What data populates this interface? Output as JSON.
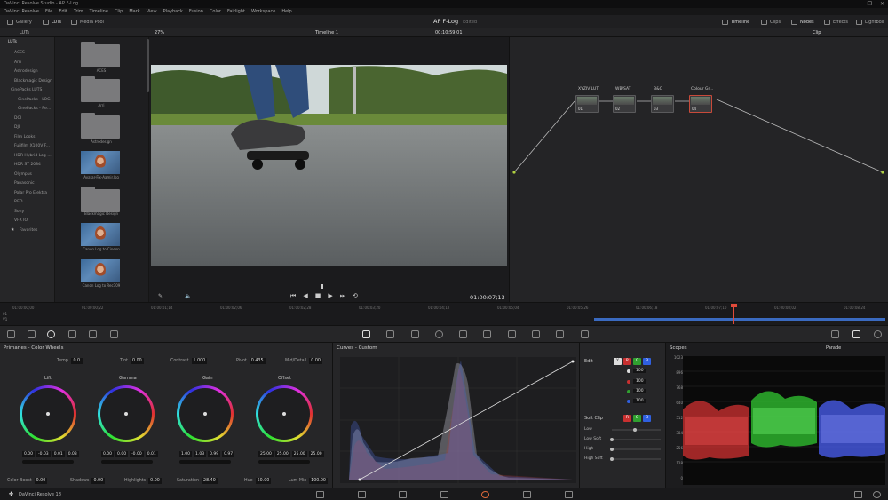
{
  "window": {
    "title": "DaVinci Resolve Studio - AP F-Log",
    "controls": [
      "–",
      "❐",
      "✕"
    ]
  },
  "menu": [
    "DaVinci Resolve",
    "File",
    "Edit",
    "Trim",
    "Timeline",
    "Clip",
    "Mark",
    "View",
    "Playback",
    "Fusion",
    "Color",
    "Fairlight",
    "Workspace",
    "Help"
  ],
  "topbar": {
    "gallery": "Gallery",
    "luts": "LUTs",
    "media_pool": "Media Pool",
    "project": "AP F-Log",
    "edited": "Edited",
    "timeline": "Timeline",
    "clips": "Clips",
    "nodes": "Nodes",
    "effects": "Effects",
    "lightbox": "Lightbox"
  },
  "subbar": {
    "luts_label": "LUTs",
    "zoom": "27%",
    "timeline_name": "Timeline 1",
    "timecode": "00:10:59;01",
    "clip_mode": "Clip"
  },
  "lut_tree": {
    "root": "LUTs",
    "items": [
      "ACES",
      "Arri",
      "Astrodesign",
      "Blackmagic Design",
      "CinePacks LUTS",
      "CinePacks - LOG",
      "CinePacks - Re...",
      "DCI",
      "DJI",
      "Film Looks",
      "Fujifilm X100V F...",
      "HDR Hybrid Log-...",
      "HDR ST 2084",
      "Olympus",
      "Panasonic",
      "Polar Pro Elektra",
      "RED",
      "Sony",
      "VFX IO",
      "Favorites"
    ]
  },
  "lut_thumbs": [
    {
      "label": "ACES",
      "kind": "folder"
    },
    {
      "label": "Arri",
      "kind": "folder"
    },
    {
      "label": "Astrodesign",
      "kind": "folder"
    },
    {
      "label": "Avatar-Fix-Aamir.lsg",
      "kind": "face"
    },
    {
      "label": "Blackmagic Design",
      "kind": "folder"
    },
    {
      "label": "Canon Log to Cineon",
      "kind": "face"
    },
    {
      "label": "Canon Log to Rec709",
      "kind": "face"
    }
  ],
  "viewer": {
    "timecode": "01:00:07;13"
  },
  "nodes": [
    {
      "label": "XYZIV LUT",
      "num": "01"
    },
    {
      "label": "WB/SAT",
      "num": "02"
    },
    {
      "label": "B&C",
      "num": "03"
    },
    {
      "label": "Colour Gr...",
      "num": "04"
    }
  ],
  "timeline_ruler": [
    "01:00:00;00",
    "01:00:00;22",
    "01:00:01;14",
    "01:00:02;06",
    "01:00:02;28",
    "01:00:03;20",
    "01:00:04;12",
    "01:00:05;04",
    "01:00:05;26",
    "01:00:06;18",
    "01:00:07;10",
    "01:00:08;02",
    "01:00:08;24"
  ],
  "track": {
    "v1": "V1",
    "number": "01"
  },
  "primaries": {
    "title": "Primaries - Color Wheels",
    "temp": {
      "label": "Temp",
      "value": "0.0"
    },
    "tint": {
      "label": "Tint",
      "value": "0.00"
    },
    "contrast": {
      "label": "Contrast",
      "value": "1.000"
    },
    "pivot": {
      "label": "Pivot",
      "value": "0.435"
    },
    "middetail": {
      "label": "Mid/Detail",
      "value": "0.00"
    },
    "wheels": [
      {
        "label": "Lift",
        "values": [
          "0.00",
          "-0.03",
          "0.01",
          "0.03"
        ]
      },
      {
        "label": "Gamma",
        "values": [
          "0.00",
          "0.00",
          "-0.00",
          "0.01"
        ]
      },
      {
        "label": "Gain",
        "values": [
          "1.00",
          "1.03",
          "0.99",
          "0.97"
        ]
      },
      {
        "label": "Offset",
        "values": [
          "25.00",
          "25.00",
          "25.00",
          "25.00"
        ]
      }
    ],
    "wheel_sub": [
      "Y",
      "R",
      "G",
      "B"
    ],
    "colorboost": {
      "label": "Color Boost",
      "value": "0.00"
    },
    "shadows": {
      "label": "Shadows",
      "value": "0.00"
    },
    "highlights": {
      "label": "Highlights",
      "value": "0.00"
    },
    "saturation": {
      "label": "Saturation",
      "value": "28.40"
    },
    "hue": {
      "label": "Hue",
      "value": "50.00"
    },
    "lummix": {
      "label": "Lum Mix",
      "value": "100.00"
    }
  },
  "curves": {
    "title": "Curves - Custom"
  },
  "edit": {
    "title": "Edit",
    "channels": [
      "Y",
      "R",
      "G",
      "B"
    ],
    "values": [
      "100",
      "100",
      "100",
      "100"
    ],
    "softclip": "Soft Clip",
    "soft_items": [
      "Low",
      "Low Soft",
      "High",
      "High Soft"
    ]
  },
  "scopes": {
    "title": "Scopes",
    "mode": "Parade",
    "scale": [
      "1023",
      "896",
      "768",
      "640",
      "512",
      "384",
      "256",
      "128",
      "0"
    ]
  },
  "status": {
    "app": "DaVinci Resolve 18"
  },
  "colors": {
    "accent": "#c84a3a",
    "red": "#d03030",
    "green": "#30b030",
    "blue": "#3060e0"
  }
}
